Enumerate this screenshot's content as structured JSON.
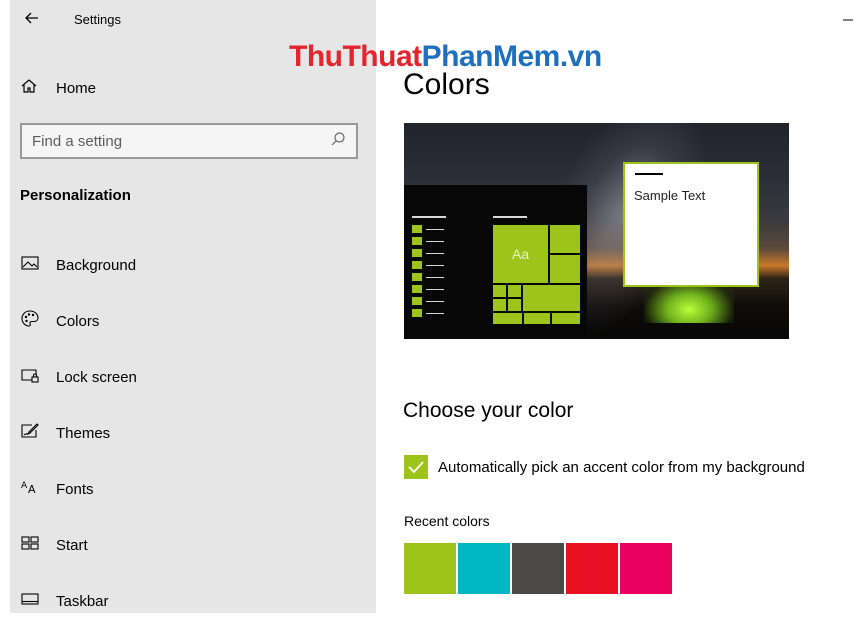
{
  "header": {
    "app_title": "Settings",
    "back_icon": "back-arrow-icon",
    "minimize_symbol": "–"
  },
  "watermark": {
    "part1": "ThuThuat",
    "part2": "PhanMem.vn"
  },
  "sidebar": {
    "home_label": "Home",
    "search_placeholder": "Find a setting",
    "section_title": "Personalization",
    "items": [
      {
        "label": "Background",
        "icon": "picture-icon"
      },
      {
        "label": "Colors",
        "icon": "palette-icon"
      },
      {
        "label": "Lock screen",
        "icon": "lock-screen-icon"
      },
      {
        "label": "Themes",
        "icon": "themes-brush-icon"
      },
      {
        "label": "Fonts",
        "icon": "fonts-icon"
      },
      {
        "label": "Start",
        "icon": "start-tiles-icon"
      },
      {
        "label": "Taskbar",
        "icon": "taskbar-icon"
      }
    ]
  },
  "main": {
    "page_title": "Colors",
    "preview": {
      "sample_text": "Sample Text",
      "tile_text": "Aa"
    },
    "choose_heading": "Choose your color",
    "auto_accent_label": "Automatically pick an accent color from my background",
    "auto_accent_checked": true,
    "recent_colors_label": "Recent colors",
    "recent_colors": [
      "#9cc41b",
      "#00b7c3",
      "#4c4a48",
      "#e81123",
      "#ea005e"
    ]
  },
  "colors": {
    "accent": "#9cc41b",
    "sidebar_bg": "#e6e6e6"
  }
}
